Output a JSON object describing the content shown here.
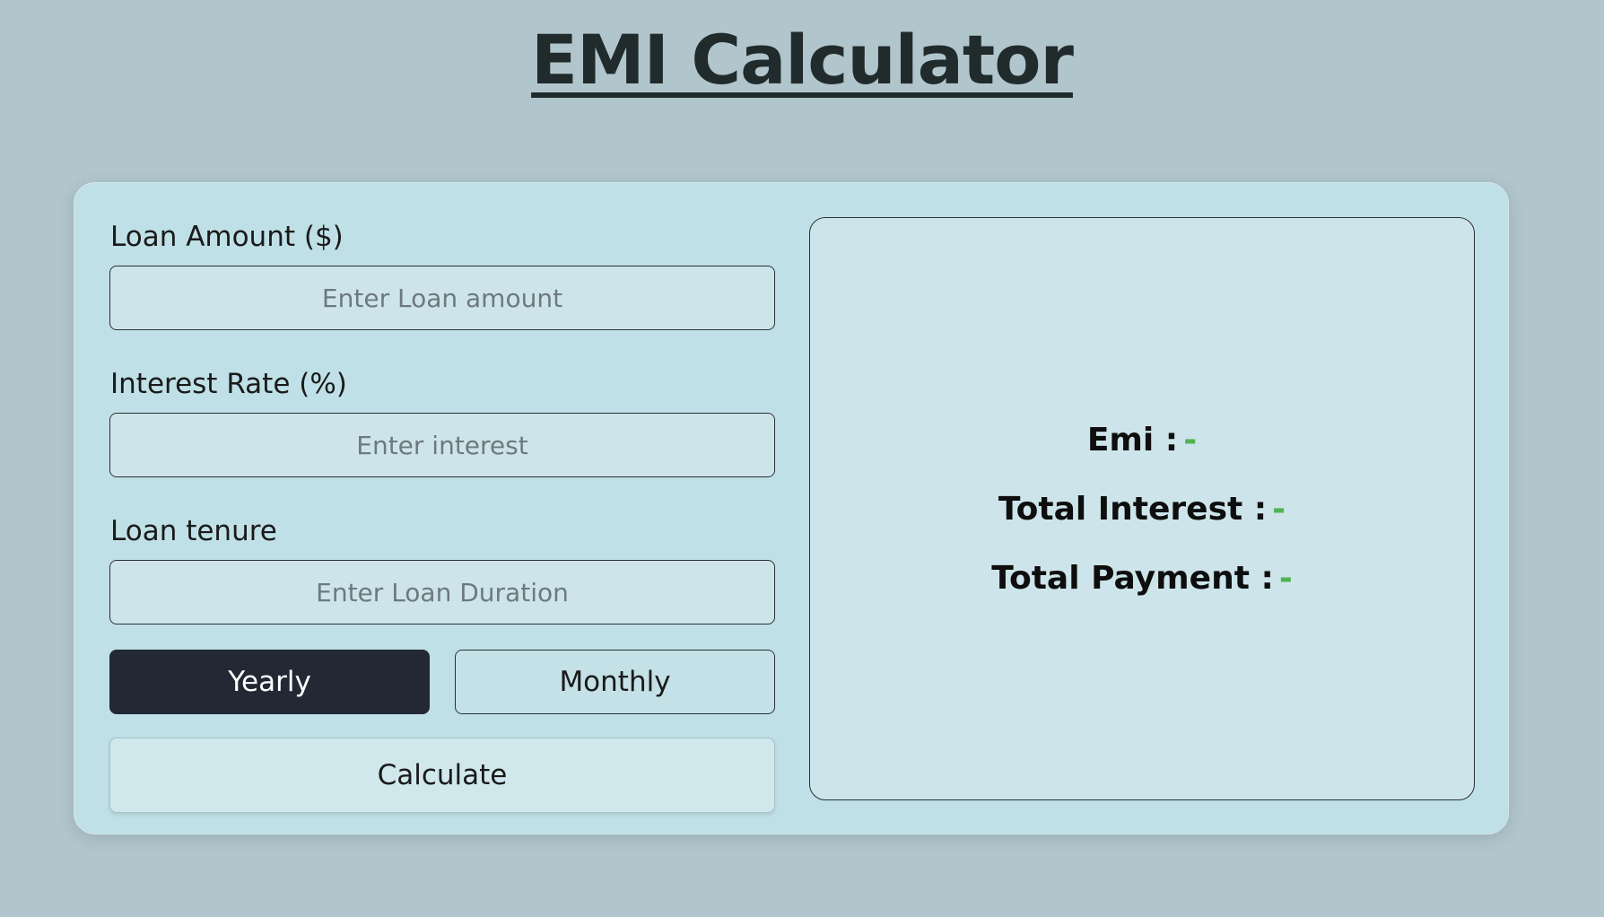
{
  "page": {
    "title": "EMI Calculator"
  },
  "form": {
    "loan_amount": {
      "label": "Loan Amount ($)",
      "placeholder": "Enter Loan amount",
      "value": ""
    },
    "interest_rate": {
      "label": "Interest Rate (%)",
      "placeholder": "Enter interest",
      "value": ""
    },
    "loan_tenure": {
      "label": "Loan tenure",
      "placeholder": "Enter Loan Duration",
      "value": ""
    },
    "tenure_unit": {
      "options": [
        "Yearly",
        "Monthly"
      ],
      "selected": "Yearly"
    },
    "calculate_label": "Calculate"
  },
  "results": {
    "emi": {
      "label": "Emi :",
      "value": "-"
    },
    "total_interest": {
      "label": "Total Interest :",
      "value": "-"
    },
    "total_payment": {
      "label": "Total Payment :",
      "value": "-"
    }
  },
  "colors": {
    "background": "#b0c6cc",
    "card": "#bfe0e6",
    "active_toggle": "#222834",
    "result_value": "#52b352"
  }
}
